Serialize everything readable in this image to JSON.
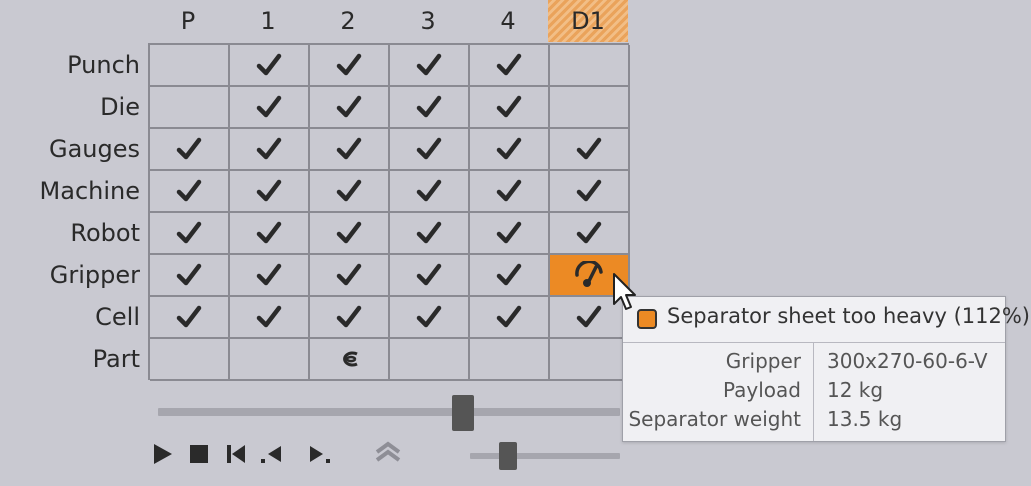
{
  "columns": [
    "P",
    "1",
    "2",
    "3",
    "4",
    "D1"
  ],
  "active_column": "D1",
  "rows": [
    {
      "label": "Punch",
      "cells": [
        "",
        "check",
        "check",
        "check",
        "check",
        ""
      ]
    },
    {
      "label": "Die",
      "cells": [
        "",
        "check",
        "check",
        "check",
        "check",
        ""
      ]
    },
    {
      "label": "Gauges",
      "cells": [
        "check",
        "check",
        "check",
        "check",
        "check",
        "check"
      ]
    },
    {
      "label": "Machine",
      "cells": [
        "check",
        "check",
        "check",
        "check",
        "check",
        "check"
      ]
    },
    {
      "label": "Robot",
      "cells": [
        "check",
        "check",
        "check",
        "check",
        "check",
        "check"
      ]
    },
    {
      "label": "Gripper",
      "cells": [
        "check",
        "check",
        "check",
        "check",
        "check",
        "gauge-warning"
      ]
    },
    {
      "label": "Cell",
      "cells": [
        "check",
        "check",
        "check",
        "check",
        "check",
        "check"
      ]
    },
    {
      "label": "Part",
      "cells": [
        "",
        "",
        "part",
        "",
        "",
        ""
      ]
    }
  ],
  "colors": {
    "warning": "#ec8a24",
    "active_header": "#eaa35b"
  },
  "timeline_slider": {
    "value_fraction": 0.66
  },
  "speed_slider": {
    "value_fraction": 0.25
  },
  "controls": [
    "play-icon",
    "stop-icon",
    "skip-back-icon",
    "step-back-icon",
    "step-forward-icon",
    "collapse-up-icon"
  ],
  "tooltip": {
    "title": "Separator sheet too heavy (112%)",
    "rows": [
      {
        "key": "Gripper",
        "value": "300x270-60-6-V"
      },
      {
        "key": "Payload",
        "value": "12 kg"
      },
      {
        "key": "Separator weight",
        "value": "13.5 kg"
      }
    ]
  }
}
